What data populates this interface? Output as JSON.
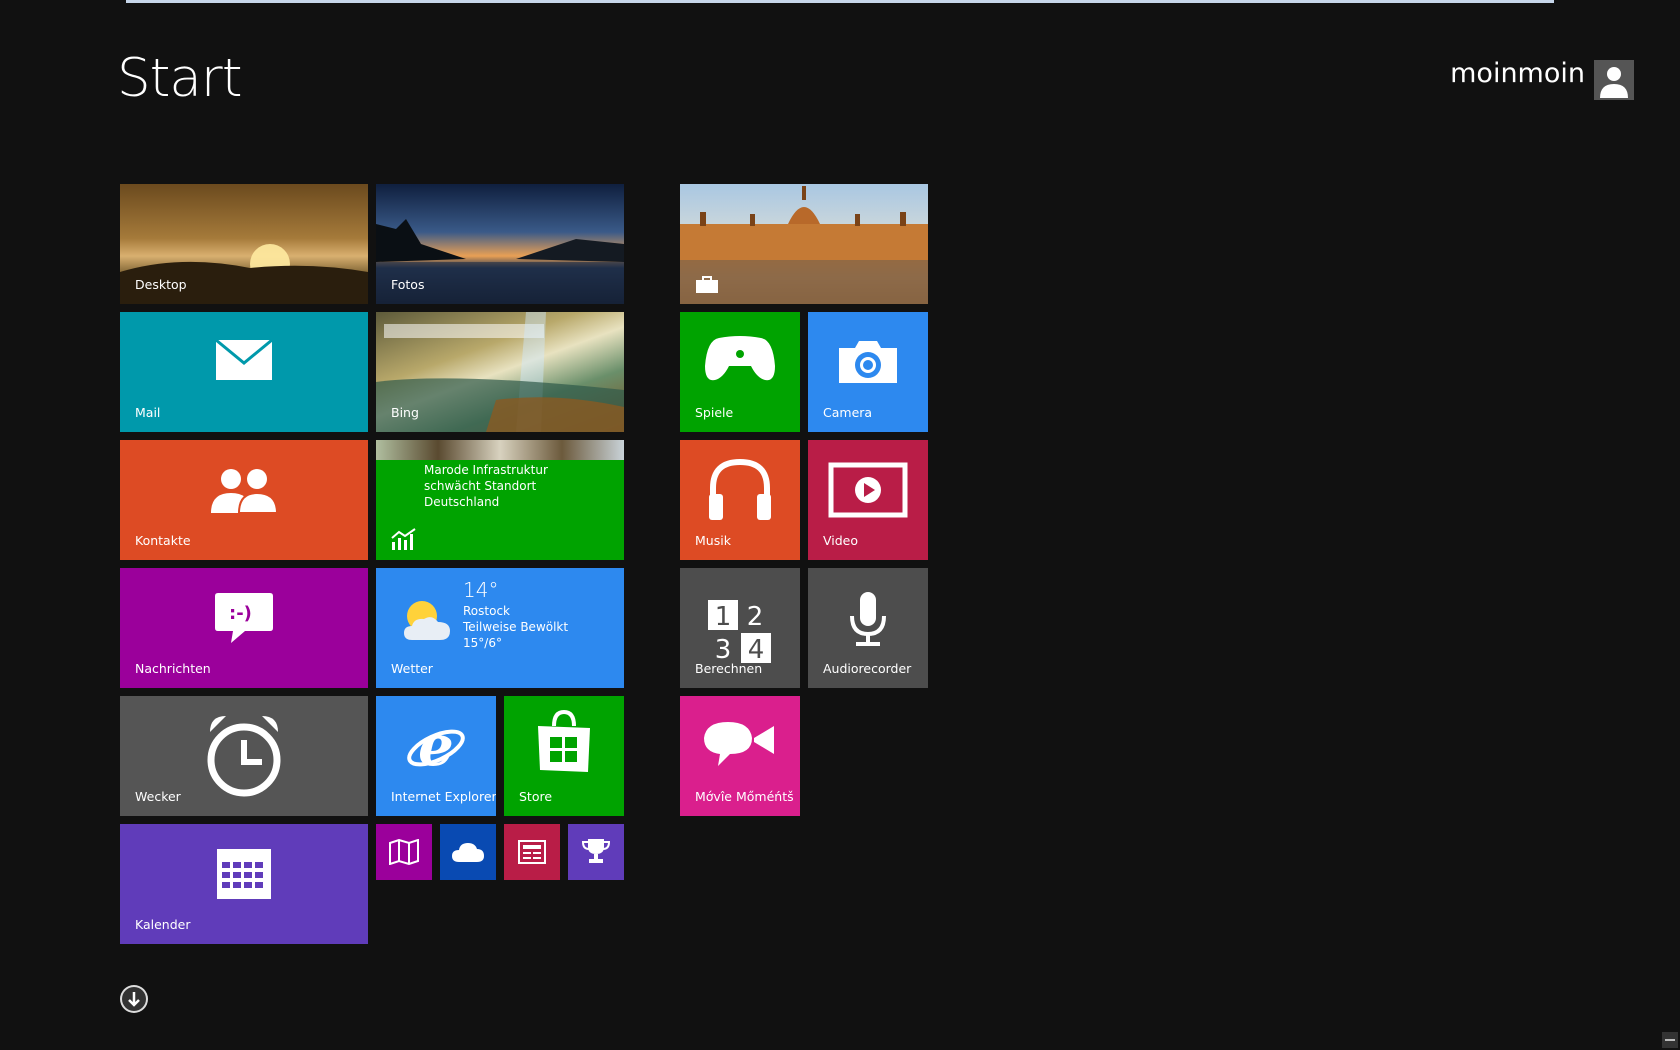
{
  "screen": {
    "title": "Start",
    "username": "moinmoin"
  },
  "tiles": {
    "desktop": {
      "label": "Desktop"
    },
    "fotos": {
      "label": "Fotos"
    },
    "mail": {
      "label": "Mail"
    },
    "bing": {
      "label": "Bing"
    },
    "kontakte": {
      "label": "Kontakte"
    },
    "finanzen": {
      "lines": [
        "Marode Infrastruktur",
        "schwächt Standort",
        "Deutschland"
      ]
    },
    "nachrichten": {
      "label": "Nachrichten"
    },
    "wetter": {
      "label": "Wetter",
      "temperature": "14°",
      "city": "Rostock",
      "condition": "Teilweise Bewölkt",
      "range": "15°/6°"
    },
    "wecker": {
      "label": "Wecker"
    },
    "ie": {
      "label": "Internet Explorer"
    },
    "store": {
      "label": "Store"
    },
    "kalender": {
      "label": "Kalender"
    },
    "spiele": {
      "label": "Spiele"
    },
    "camera": {
      "label": "Camera"
    },
    "musik": {
      "label": "Musik"
    },
    "video": {
      "label": "Video"
    },
    "berechnen": {
      "label": "Berechnen"
    },
    "audiorecorder": {
      "label": "Audiorecorder"
    },
    "movie": {
      "label": "Mớvîe Mőméńtš"
    }
  },
  "colors": {
    "background": "#111111",
    "mail": "#0099ab",
    "kontakte": "#dd4b24",
    "finanzen": "#00a300",
    "nachrichten": "#9b009b",
    "wetter": "#2d89ef",
    "wecker": "#555555",
    "ie": "#2d89ef",
    "store": "#00a300",
    "kalender": "#603cba",
    "spiele": "#00a300",
    "camera": "#2d89ef",
    "musik": "#dd4b24",
    "video": "#b91d47",
    "berechnen": "#4d4d4d",
    "audiorecorder": "#4d4d4d",
    "movie": "#da1f8d",
    "maps": "#9b009b",
    "skydrive": "#094ab2",
    "news": "#b91d47",
    "trophy": "#603cba"
  },
  "icons": [
    "mail-icon",
    "people-icon",
    "finance-chart-icon",
    "chat-icon",
    "sun-cloud-icon",
    "alarm-clock-icon",
    "ie-icon",
    "store-bag-icon",
    "calendar-icon",
    "gamepad-icon",
    "camera-icon",
    "headphones-icon",
    "video-icon",
    "calculator-icon",
    "microphone-icon",
    "video-chat-icon",
    "map-icon",
    "cloud-icon",
    "newspaper-icon",
    "trophy-icon",
    "briefcase-icon",
    "user-icon",
    "arrow-down-icon"
  ]
}
